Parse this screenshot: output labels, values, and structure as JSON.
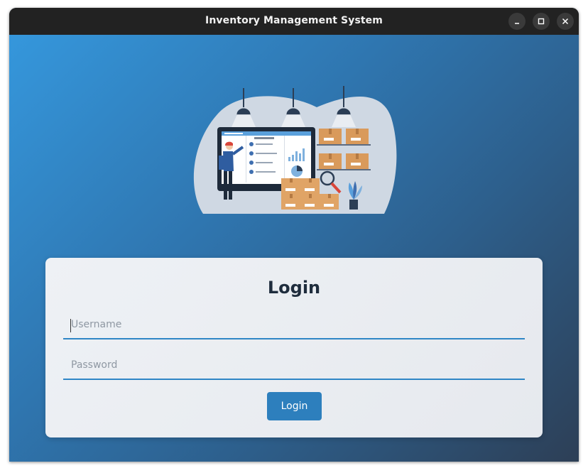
{
  "window": {
    "title": "Inventory Management System",
    "controls": [
      "minimize-icon",
      "maximize-icon",
      "close-icon"
    ]
  },
  "illustration": {
    "icon": "warehouse-inventory-illustration"
  },
  "login": {
    "heading": "Login",
    "username_placeholder": "Username",
    "username_value": "",
    "password_placeholder": "Password",
    "password_value": "",
    "button_label": "Login"
  },
  "colors": {
    "titlebar": "#222222",
    "gradient_start": "#3597dc",
    "gradient_end": "#2d3f56",
    "accent": "#2f86c6",
    "button": "#2d7fbd",
    "card": "#eceff3"
  }
}
